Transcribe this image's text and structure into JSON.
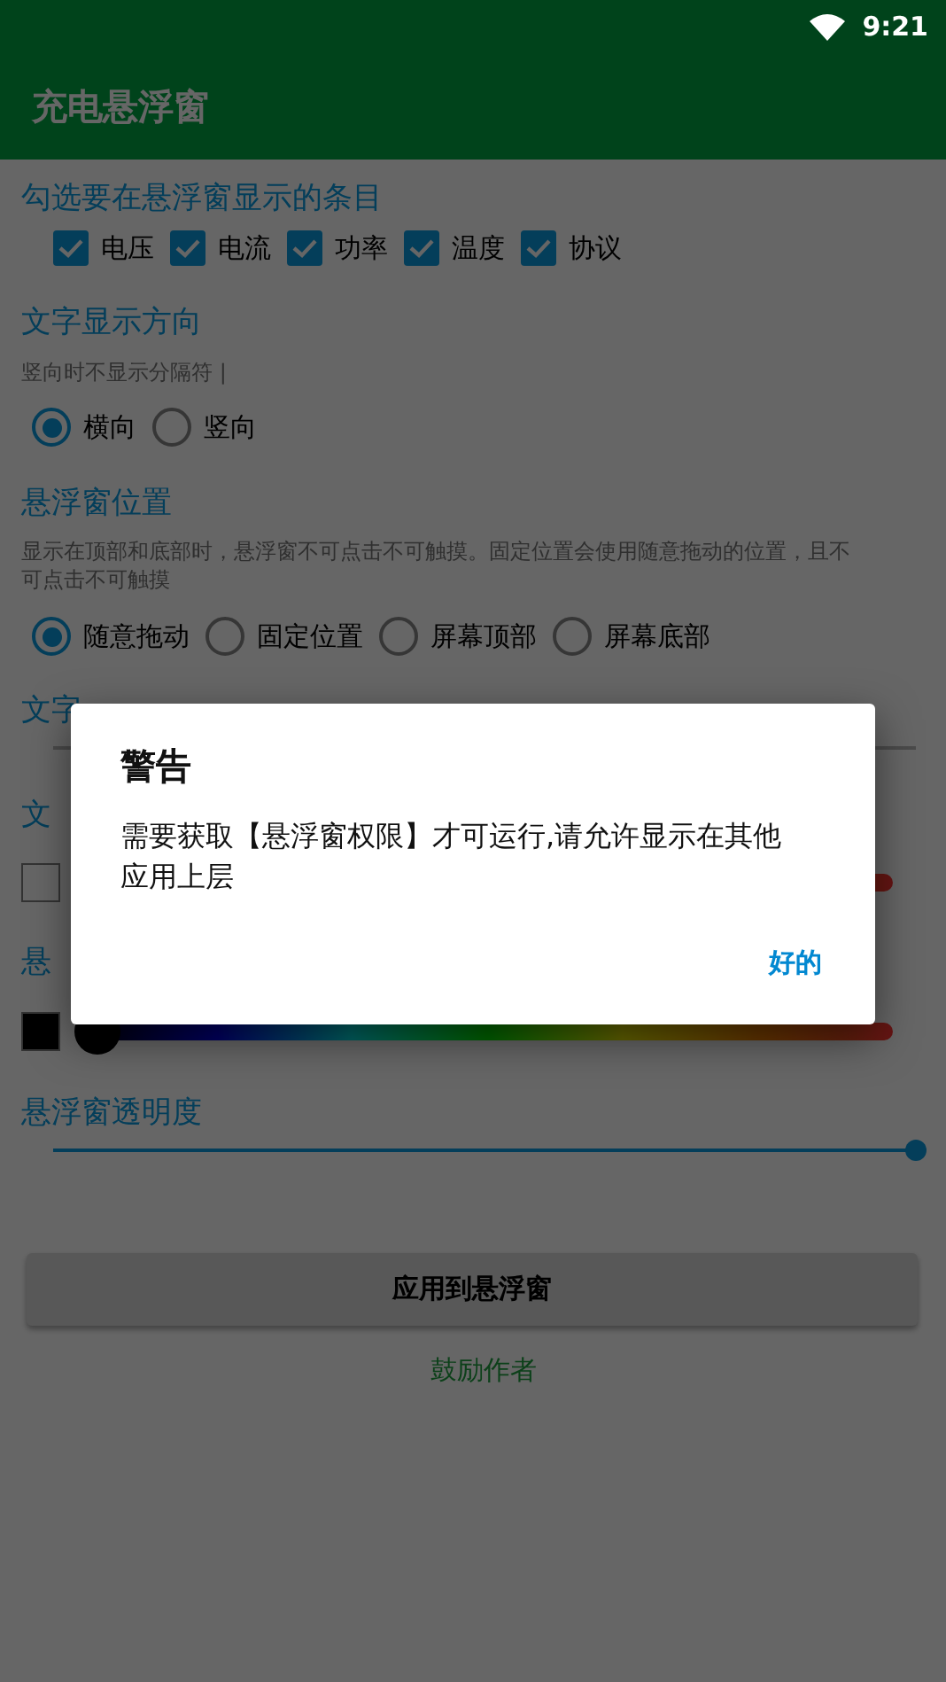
{
  "status_bar": {
    "time": "9:21"
  },
  "app_bar": {
    "title": "充电悬浮窗"
  },
  "display_items": {
    "heading": "勾选要在悬浮窗显示的条目",
    "options": [
      {
        "label": "电压",
        "checked": true
      },
      {
        "label": "电流",
        "checked": true
      },
      {
        "label": "功率",
        "checked": true
      },
      {
        "label": "温度",
        "checked": true
      },
      {
        "label": "协议",
        "checked": true
      }
    ]
  },
  "text_direction": {
    "heading": "文字显示方向",
    "hint": "竖向时不显示分隔符 |",
    "options": [
      {
        "label": "横向",
        "selected": true
      },
      {
        "label": "竖向",
        "selected": false
      }
    ]
  },
  "window_position": {
    "heading": "悬浮窗位置",
    "hint": "显示在顶部和底部时，悬浮窗不可点击不可触摸。固定位置会使用随意拖动的位置，且不可点击不可触摸",
    "options": [
      {
        "label": "随意拖动",
        "selected": true
      },
      {
        "label": "固定位置",
        "selected": false
      },
      {
        "label": "屏幕顶部",
        "selected": false
      },
      {
        "label": "屏幕底部",
        "selected": false
      }
    ]
  },
  "text_size": {
    "heading": "文字"
  },
  "text_color": {
    "heading": "文",
    "color": "#666666"
  },
  "background_color": {
    "heading": "悬",
    "color": "#000000",
    "level": 0
  },
  "opacity": {
    "heading": "悬浮窗透明度",
    "level": 1
  },
  "apply_button": "应用到悬浮窗",
  "support_link": "鼓励作者",
  "dialog": {
    "title": "警告",
    "message": "需要获取【悬浮窗权限】才可运行,请允许显示在其他应用上层",
    "button": "好的"
  }
}
